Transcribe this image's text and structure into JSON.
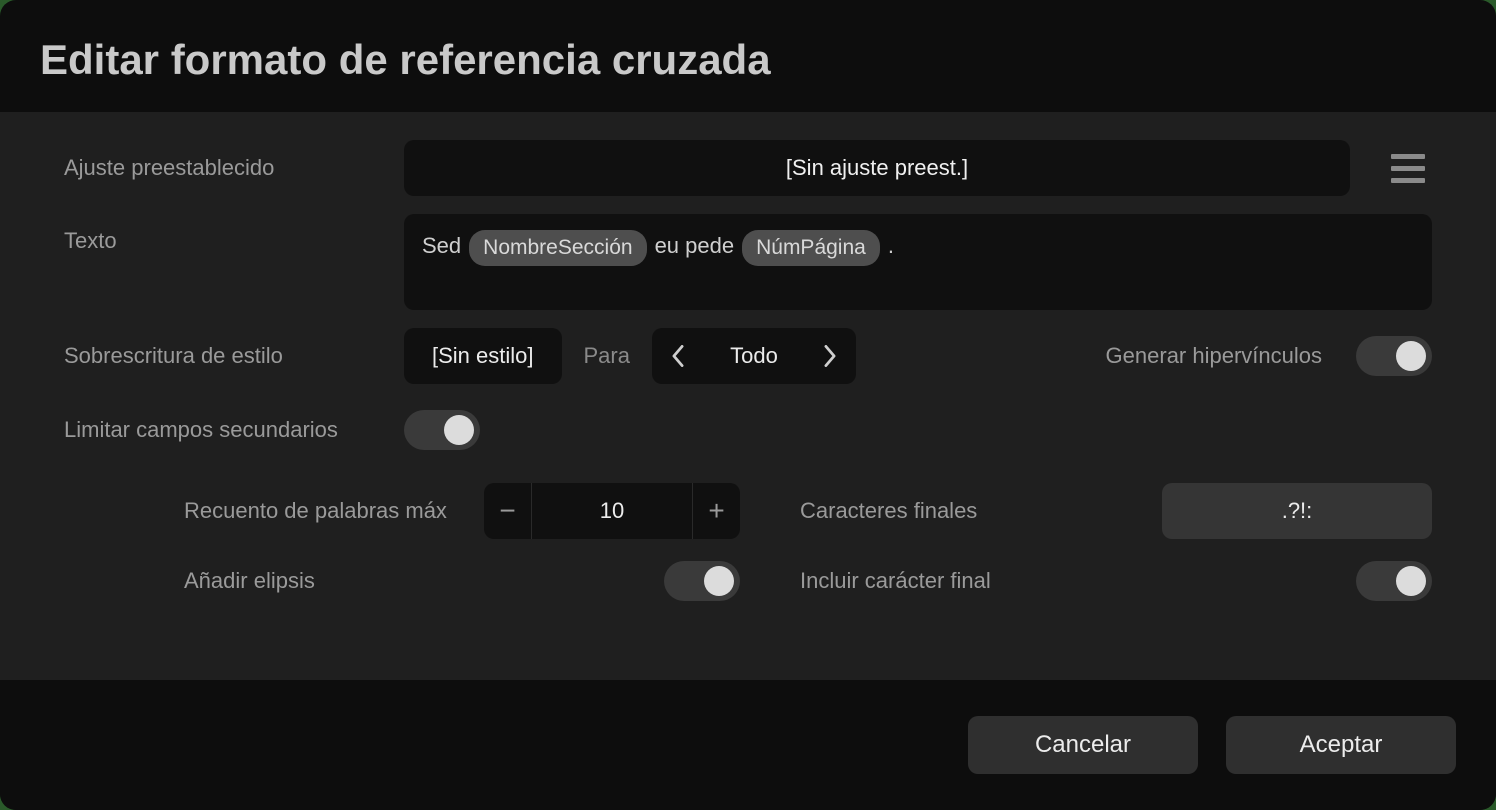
{
  "dialog": {
    "title": "Editar formato de referencia cruzada"
  },
  "preset": {
    "label": "Ajuste preestablecido",
    "value": "[Sin ajuste preest.]"
  },
  "text_template": {
    "label": "Texto",
    "parts": {
      "t1": "Sed",
      "tok1": "NombreSección",
      "t2": "eu pede",
      "tok2": "NúmPágina",
      "t3": "."
    }
  },
  "style_override": {
    "label": "Sobrescritura de estilo",
    "value": "[Sin estilo]",
    "for_label": "Para",
    "scope_value": "Todo"
  },
  "hyperlinks": {
    "label": "Generar hipervínculos",
    "enabled": true
  },
  "limit_subfields": {
    "label": "Limitar campos secundarios",
    "enabled": true
  },
  "max_words": {
    "label": "Recuento de palabras máx",
    "value": "10"
  },
  "end_chars": {
    "label": "Caracteres finales",
    "value": ".?!:"
  },
  "add_ellipsis": {
    "label": "Añadir elipsis",
    "enabled": true
  },
  "include_end_char": {
    "label": "Incluir carácter final",
    "enabled": true
  },
  "footer": {
    "cancel": "Cancelar",
    "accept": "Aceptar"
  }
}
